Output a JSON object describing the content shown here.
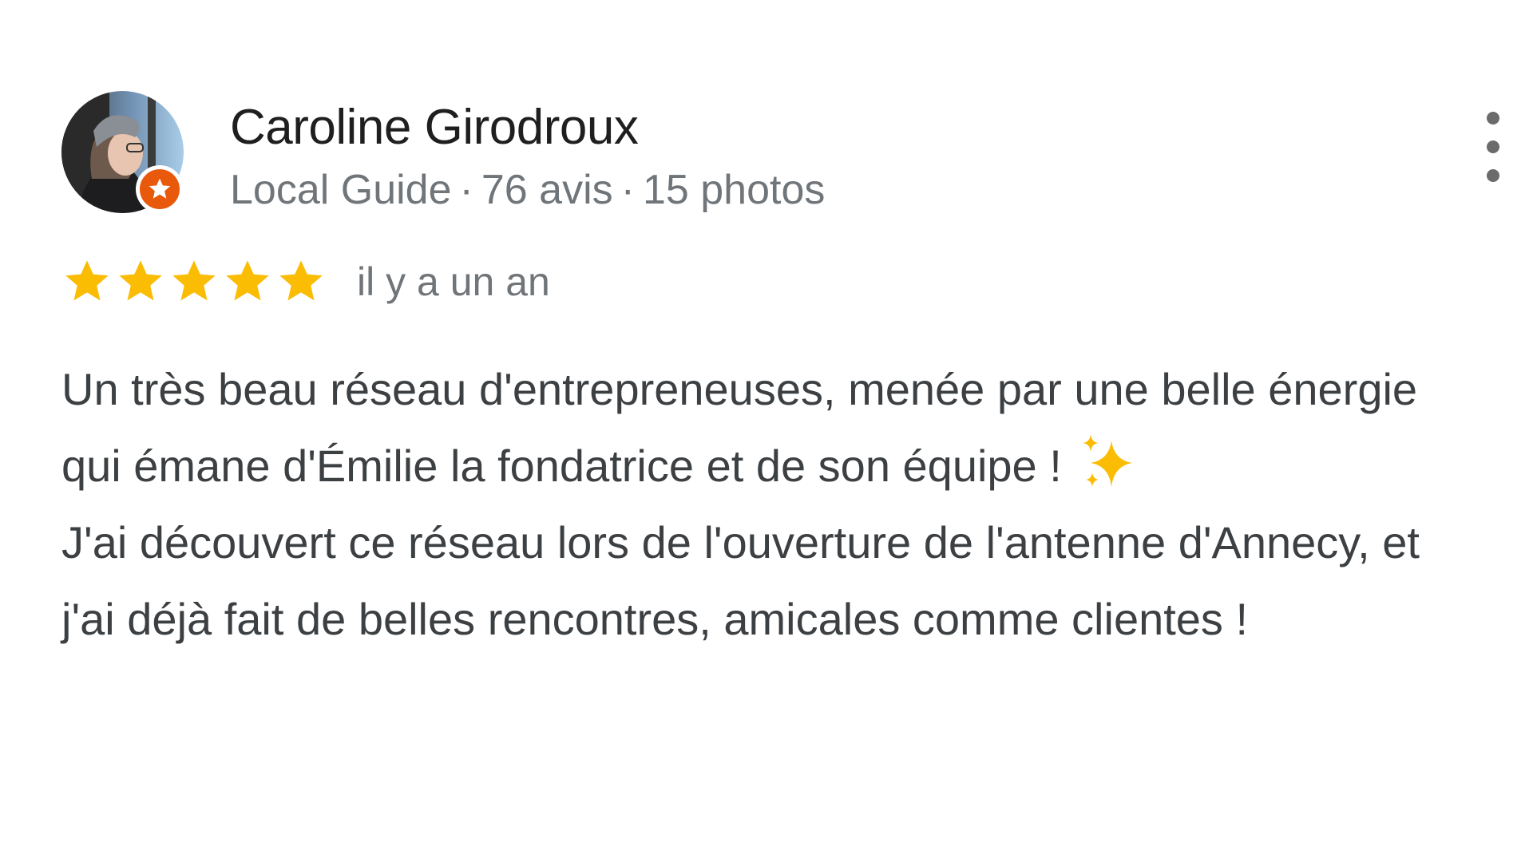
{
  "reviewer": {
    "name": "Caroline Girodroux",
    "badge": "Local Guide",
    "reviews": "76 avis",
    "photos": "15 photos",
    "separator": "·"
  },
  "rating": {
    "value": 5,
    "max": 5,
    "time_ago": "il y a un an"
  },
  "review": {
    "paragraph_1": "Un très beau réseau d'entrepreneuses, menée par une belle énergie qui émane d'Émilie la fondatrice et de son équipe !",
    "paragraph_2": "J'ai découvert ce réseau lors de l'ouverture de l'antenne d'Annecy, et j'ai déjà fait de belles rencontres, amicales comme clientes !"
  },
  "icons": {
    "avatar": "profile-photo",
    "guide_badge": "star-badge-icon",
    "menu": "more-vertical-icon",
    "star": "star-icon",
    "emoji": "sparkles-icon"
  },
  "colors": {
    "star": "#fbbc04",
    "badge": "#e8590c",
    "name": "#1f1f1f",
    "meta": "#70757a",
    "body": "#3c4043"
  }
}
